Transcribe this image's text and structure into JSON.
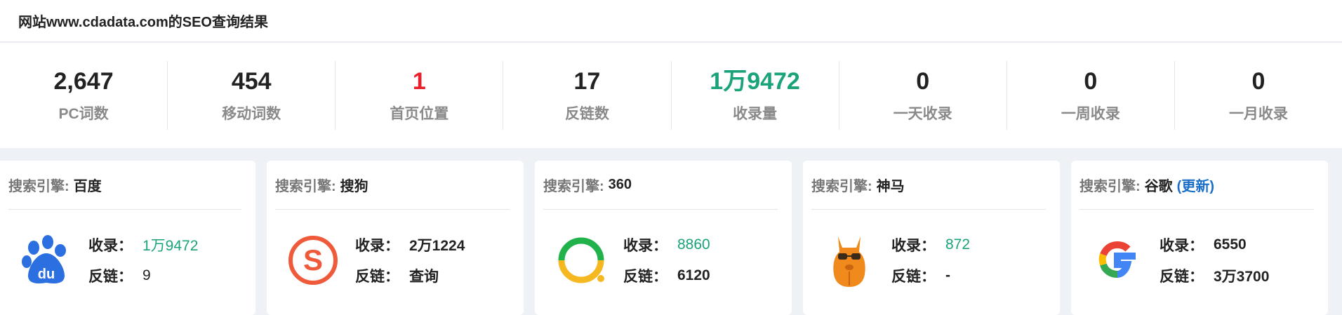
{
  "header": {
    "title": "网站www.cdadata.com的SEO查询结果"
  },
  "stats": [
    {
      "value": "2,647",
      "label": "PC词数",
      "color": "#222222"
    },
    {
      "value": "454",
      "label": "移动词数",
      "color": "#222222"
    },
    {
      "value": "1",
      "label": "首页位置",
      "color": "#e8202a"
    },
    {
      "value": "17",
      "label": "反链数",
      "color": "#222222"
    },
    {
      "value": "1万9472",
      "label": "收录量",
      "color": "#1aa37a"
    },
    {
      "value": "0",
      "label": "一天收录",
      "color": "#222222"
    },
    {
      "value": "0",
      "label": "一周收录",
      "color": "#222222"
    },
    {
      "value": "0",
      "label": "一月收录",
      "color": "#222222"
    }
  ],
  "engine_key": "搜索引擎:",
  "index_key": "收录：",
  "backlink_key": "反链：",
  "engines": [
    {
      "name": "百度",
      "index": "1万9472",
      "backlinks": "9",
      "icon": "baidu-paw-icon"
    },
    {
      "name": "搜狗",
      "index": "2万1224",
      "backlinks": "查询",
      "icon": "sogou-s-icon"
    },
    {
      "name": "360",
      "index": "8860",
      "backlinks": "6120",
      "icon": "360-ring-icon"
    },
    {
      "name": "神马",
      "index": "872",
      "backlinks": "-",
      "icon": "shenma-alpaca-icon"
    },
    {
      "name": "谷歌",
      "update": "(更新)",
      "index": "6550",
      "backlinks": "3万3700",
      "icon": "google-g-icon"
    }
  ],
  "colors": {
    "green": "#1aa37a",
    "red": "#e8202a",
    "link": "#1b6fc9"
  }
}
